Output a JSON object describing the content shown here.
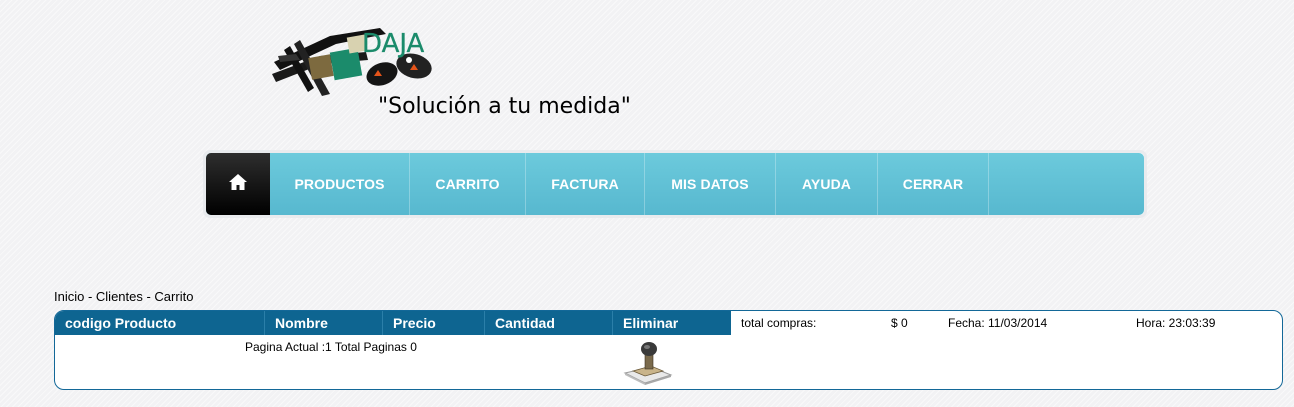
{
  "header": {
    "logo_text": "DAJA",
    "slogan": "\"Solución a tu medida\""
  },
  "nav": {
    "home_icon": "home-icon",
    "items": [
      "PRODUCTOS",
      "CARRITO",
      "FACTURA",
      "MIS DATOS",
      "AYUDA",
      "CERRAR"
    ]
  },
  "breadcrumb": "Inicio - Clientes - Carrito",
  "cart": {
    "columns": [
      "codigo Producto",
      "Nombre",
      "Precio",
      "Cantidad",
      "Eliminar"
    ],
    "pager": "Pagina Actual :1 Total Paginas 0",
    "delete_icon": "rubber-stamp-icon"
  },
  "summary": {
    "total_label": "total compras:",
    "total_value": "$ 0",
    "date": "Fecha: 11/03/2014",
    "time": "Hora: 23:03:39"
  },
  "colors": {
    "nav": "#5ebfd5",
    "home": "#111111",
    "table_header": "#0e6591",
    "accent_green": "#1b8b6b",
    "accent_orange": "#e5541a"
  }
}
